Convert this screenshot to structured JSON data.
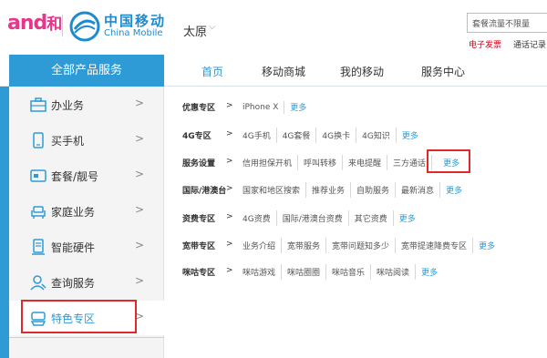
{
  "header": {
    "logo_text": "and",
    "logo_he": "和",
    "brand_cn": "中国移动",
    "brand_en": "China Mobile",
    "city": "太原",
    "search_placeholder": "套餐流量不限量",
    "link_invoice": "电子发票",
    "link_history": "通话记录"
  },
  "nav": {
    "all_services": "全部产品服务",
    "items": [
      "首页",
      "移动商城",
      "我的移动",
      "服务中心"
    ]
  },
  "sidebar": {
    "items": [
      {
        "label": "办业务",
        "icon": "briefcase-icon"
      },
      {
        "label": "买手机",
        "icon": "phone-icon"
      },
      {
        "label": "套餐/靓号",
        "icon": "sim-card-icon"
      },
      {
        "label": "家庭业务",
        "icon": "sofa-icon"
      },
      {
        "label": "智能硬件",
        "icon": "smart-device-icon"
      },
      {
        "label": "查询服务",
        "icon": "user-search-icon"
      },
      {
        "label": "特色专区",
        "icon": "special-zone-icon"
      }
    ],
    "chevron": ">"
  },
  "content": {
    "separator": ">",
    "more": "更多",
    "rows": [
      {
        "title": "优惠专区",
        "links": [
          "iPhone X"
        ]
      },
      {
        "title": "4G专区",
        "links": [
          "4G手机",
          "4G套餐",
          "4G换卡",
          "4G知识"
        ]
      },
      {
        "title": "服务设置",
        "links": [
          "信用担保开机",
          "呼叫转移",
          "来电提醒",
          "三方通话"
        ]
      },
      {
        "title": "国际/港澳台",
        "links": [
          "国家和地区搜索",
          "推荐业务",
          "自助服务",
          "最新消息"
        ]
      },
      {
        "title": "资费专区",
        "links": [
          "4G资费",
          "国际/港澳台资费",
          "其它资费"
        ]
      },
      {
        "title": "宽带专区",
        "links": [
          "业务介绍",
          "宽带服务",
          "宽带问题知多少",
          "宽带提速降费专区"
        ]
      },
      {
        "title": "咪咕专区",
        "links": [
          "咪咕游戏",
          "咪咕圈圈",
          "咪咕音乐",
          "咪咕阅读"
        ]
      }
    ]
  },
  "colors": {
    "brand_blue": "#2e9bd6",
    "highlight_red": "#e02a2a",
    "logo_pink": "#e7378c"
  }
}
